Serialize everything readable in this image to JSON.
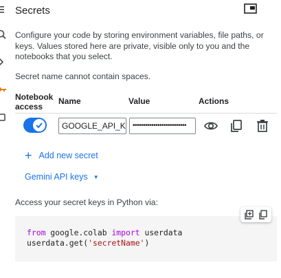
{
  "panel": {
    "title": "Secrets",
    "description": "Configure your code by storing environment variables, file paths, or keys. Values stored here are private, visible only to you and the notebooks that you select.",
    "note": "Secret name cannot contain spaces."
  },
  "table": {
    "headers": {
      "notebook_access": "Notebook access",
      "name": "Name",
      "value": "Value",
      "actions": "Actions"
    },
    "rows": [
      {
        "notebook_access": true,
        "name": "GOOGLE_API_KEY",
        "value": "••••••••••••••••••••••••••"
      }
    ]
  },
  "add_secret_label": "Add new secret",
  "gemini_label": "Gemini API keys",
  "access_text": "Access your secret keys in Python via:",
  "code": {
    "line1_kw1": "from",
    "line1_mod": " google.colab ",
    "line1_kw2": "import",
    "line1_rest": " userdata",
    "line2_pre": "userdata.get(",
    "line2_str": "'secretName'",
    "line2_post": ")"
  },
  "icons": {
    "menu": "menu-icon",
    "search": "search-icon",
    "chevron": "chevron-right-icon",
    "key": "key-icon",
    "folder": "folder-icon",
    "open_tab": "open-in-tab-icon",
    "close": "close-icon",
    "eye": "visibility-icon",
    "copy": "copy-icon",
    "delete": "delete-icon",
    "insert": "insert-code-icon"
  },
  "colors": {
    "accent": "#1a73e8",
    "keyword": "#af00db",
    "string": "#a31515",
    "key_icon": "#e37400"
  }
}
